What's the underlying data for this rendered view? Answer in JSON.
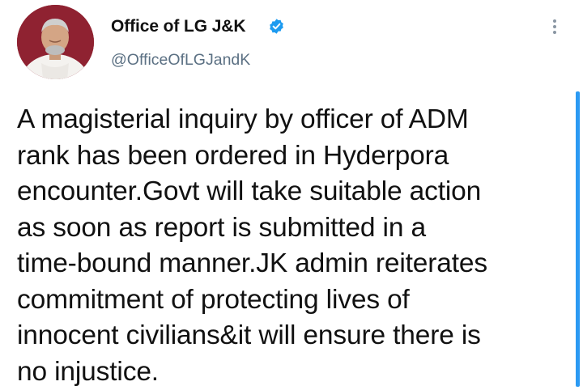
{
  "tweet": {
    "author": {
      "display_name": "Office of LG J&K",
      "handle": "@OfficeOfLGJandK",
      "verified": true,
      "avatar_icon": "profile-photo"
    },
    "text": "A magisterial inquiry by officer of ADM\nrank has been ordered in Hyderpora\nencounter.Govt will take suitable action\nas soon as report is submitted in a\ntime-bound manner.JK admin reiterates\ncommitment of protecting lives of\ninnocent civilians&it will ensure there is\nno injustice.",
    "more_icon": "more-vertical-icon"
  },
  "colors": {
    "verified_badge": "#1d9bf0",
    "avatar_background": "#8f2231",
    "handle_text": "#5b7083",
    "scrollbar": "#2b9af3"
  }
}
